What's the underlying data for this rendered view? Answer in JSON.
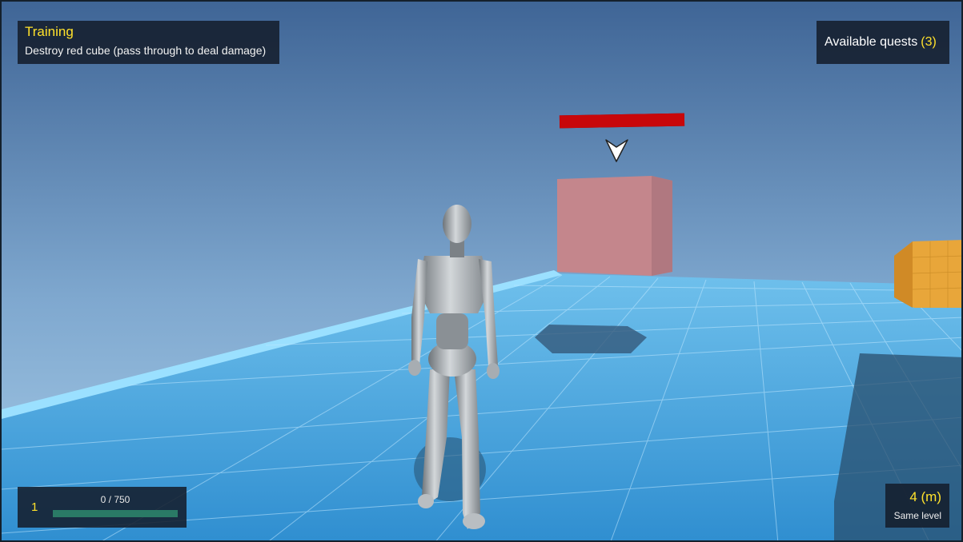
{
  "quest": {
    "title": "Training",
    "description": "Destroy red cube (pass through to deal damage)"
  },
  "available_quests": {
    "label": "Available quests",
    "count": "(3)"
  },
  "player": {
    "level": "1",
    "xp_text": "0 / 750",
    "xp_fraction": 0
  },
  "target": {
    "distance": "4 (m)",
    "relation": "Same level",
    "health_fraction": 1.0
  },
  "colors": {
    "accent_yellow": "#ffe12b",
    "health_red": "#c8070a",
    "target_cube": "#c4868c",
    "orange_block": "#e8a63a",
    "ground_blue": "#4aa8e0",
    "xp_bar": "#2a7a66"
  }
}
